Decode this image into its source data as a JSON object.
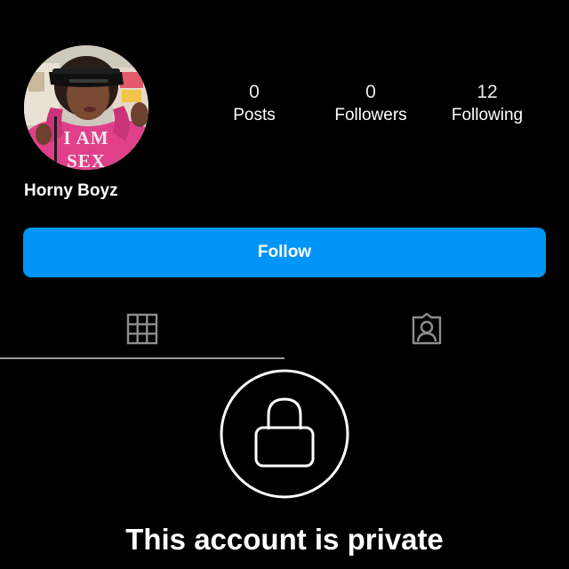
{
  "profile": {
    "username": "Horny Boyz",
    "avatar": {
      "shirt_text_line1": "I AM",
      "shirt_text_line2": "SEX",
      "shirt_color": "#e0408a"
    }
  },
  "stats": {
    "posts": {
      "count": "0",
      "label": "Posts"
    },
    "followers": {
      "count": "0",
      "label": "Followers"
    },
    "following": {
      "count": "12",
      "label": "Following"
    }
  },
  "actions": {
    "follow_label": "Follow",
    "follow_color": "#0095f6"
  },
  "tabs": [
    {
      "icon": "grid-icon",
      "active": true
    },
    {
      "icon": "tagged-person-icon",
      "active": false
    }
  ],
  "private_notice": {
    "icon": "lock-icon",
    "title": "This account is private"
  },
  "colors": {
    "background": "#000000",
    "text": "#ffffff",
    "icon_gray": "#8e8e8e"
  }
}
